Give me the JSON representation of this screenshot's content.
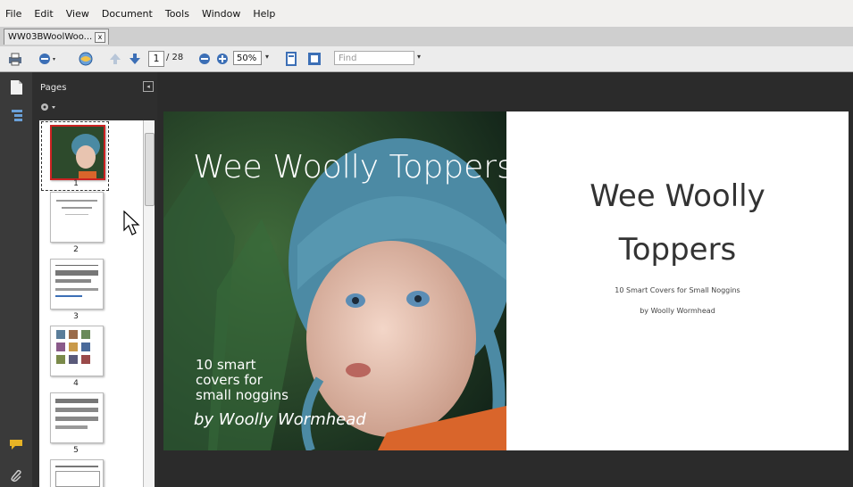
{
  "menu": [
    "File",
    "Edit",
    "View",
    "Document",
    "Tools",
    "Window",
    "Help"
  ],
  "tab": {
    "title": "WW03BWoolWoo...",
    "close": "x"
  },
  "toolbar": {
    "page_current": "1",
    "page_total": "/ 28",
    "zoom": "50%",
    "find_placeholder": "Find"
  },
  "pages_panel": {
    "title": "Pages",
    "thumbnails": [
      "1",
      "2",
      "3",
      "4",
      "5"
    ]
  },
  "document": {
    "left_page": {
      "title": "Wee Woolly Toppers",
      "subtitle_lines": [
        "10 smart",
        "covers for",
        "small noggins"
      ],
      "author": "by Woolly Wormhead"
    },
    "right_page": {
      "title_line1": "Wee Woolly",
      "title_line2": "Toppers",
      "subtitle": "10 Smart Covers for Small Noggins",
      "author": "by Woolly Wormhead"
    }
  },
  "colors": {
    "accent_blue": "#3c6fb6",
    "thumb_selected": "#cc2222"
  }
}
